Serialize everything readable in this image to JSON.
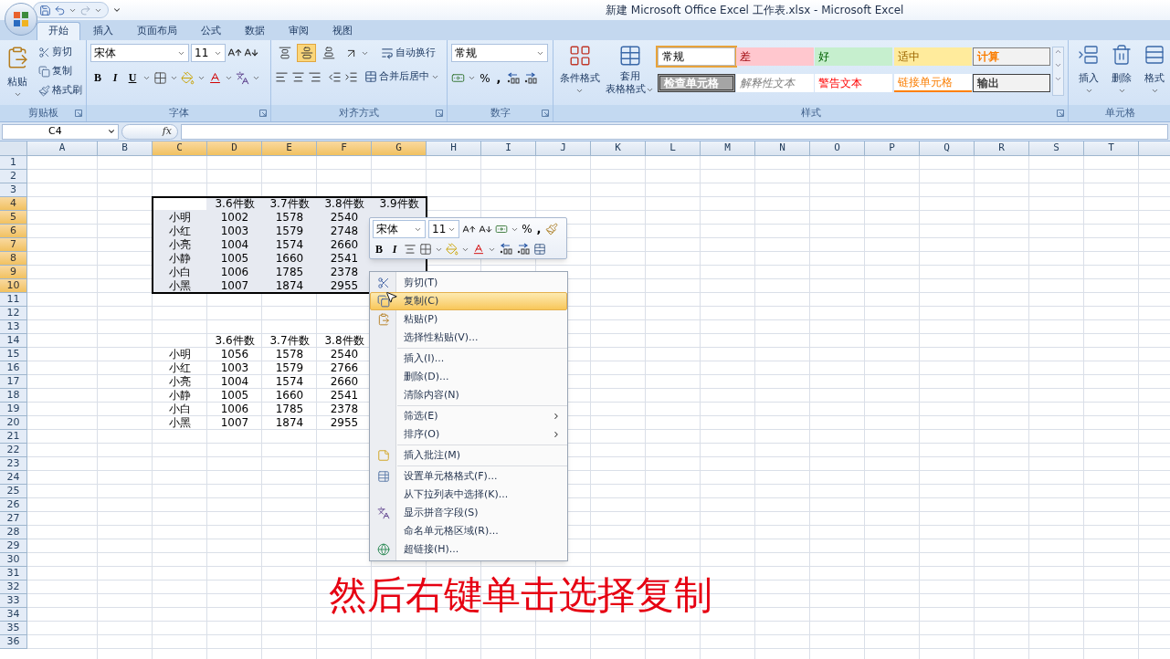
{
  "window": {
    "title": "新建 Microsoft Office Excel 工作表.xlsx - Microsoft Excel"
  },
  "tabs": [
    {
      "label": "开始",
      "selected": true
    },
    {
      "label": "插入",
      "selected": false
    },
    {
      "label": "页面布局",
      "selected": false
    },
    {
      "label": "公式",
      "selected": false
    },
    {
      "label": "数据",
      "selected": false
    },
    {
      "label": "审阅",
      "selected": false
    },
    {
      "label": "视图",
      "selected": false
    }
  ],
  "ribbon": {
    "clipboard": {
      "label": "剪贴板",
      "paste": "粘贴",
      "items": [
        {
          "kind": "cut",
          "label": "剪切"
        },
        {
          "kind": "copy",
          "label": "复制"
        },
        {
          "kind": "brush",
          "label": "格式刷"
        }
      ]
    },
    "font": {
      "label": "字体",
      "font_name": "宋体",
      "font_size": "11",
      "styles": [
        "B",
        "I",
        "U"
      ]
    },
    "alignment": {
      "label": "对齐方式",
      "vertical": [
        {
          "selected": false
        },
        {
          "selected": true
        },
        {
          "selected": false
        }
      ],
      "wrap": "自动换行",
      "merge": "合并后居中"
    },
    "number": {
      "label": "数字",
      "format": "常规",
      "percent": "%",
      "comma": ","
    },
    "styles": {
      "label": "样式",
      "conditional": "条件格式",
      "table_format": [
        "套用",
        "表格格式"
      ],
      "gallery": [
        {
          "label": "常规",
          "kind": "normal",
          "selected": true
        },
        {
          "label": "差",
          "kind": "bad",
          "selected": false
        },
        {
          "label": "好",
          "kind": "good",
          "selected": false
        },
        {
          "label": "适中",
          "kind": "neutral",
          "selected": false
        },
        {
          "label": "计算",
          "kind": "calculation",
          "selected": false
        },
        {
          "label": "检查单元格",
          "kind": "check",
          "selected": false
        },
        {
          "label": "解释性文本",
          "kind": "explanatory",
          "selected": false
        },
        {
          "label": "警告文本",
          "kind": "warning",
          "selected": false
        },
        {
          "label": "链接单元格",
          "kind": "linked",
          "selected": false
        },
        {
          "label": "输出",
          "kind": "output",
          "selected": false
        }
      ]
    },
    "cells": {
      "label": "单元格",
      "buttons": [
        "插入",
        "删除",
        "格式"
      ]
    }
  },
  "formula_bar": {
    "name_box": "C4",
    "function_label": "fx"
  },
  "sheet": {
    "columns": [
      {
        "label": "A",
        "selected": false
      },
      {
        "label": "B",
        "selected": false
      },
      {
        "label": "C",
        "selected": true
      },
      {
        "label": "D",
        "selected": true
      },
      {
        "label": "E",
        "selected": true
      },
      {
        "label": "F",
        "selected": true
      },
      {
        "label": "G",
        "selected": true
      },
      {
        "label": "H",
        "selected": false
      },
      {
        "label": "I",
        "selected": false
      },
      {
        "label": "J",
        "selected": false
      },
      {
        "label": "K",
        "selected": false
      },
      {
        "label": "L",
        "selected": false
      },
      {
        "label": "M",
        "selected": false
      },
      {
        "label": "N",
        "selected": false
      },
      {
        "label": "O",
        "selected": false
      },
      {
        "label": "P",
        "selected": false
      },
      {
        "label": "Q",
        "selected": false
      },
      {
        "label": "R",
        "selected": false
      },
      {
        "label": "S",
        "selected": false
      },
      {
        "label": "T",
        "selected": false
      }
    ],
    "rows": [
      {
        "label": "1",
        "selected": false
      },
      {
        "label": "2",
        "selected": false
      },
      {
        "label": "3",
        "selected": false
      },
      {
        "label": "4",
        "selected": true
      },
      {
        "label": "5",
        "selected": true
      },
      {
        "label": "6",
        "selected": true
      },
      {
        "label": "7",
        "selected": true
      },
      {
        "label": "8",
        "selected": true
      },
      {
        "label": "9",
        "selected": true
      },
      {
        "label": "10",
        "selected": true
      },
      {
        "label": "11",
        "selected": false
      },
      {
        "label": "12",
        "selected": false
      },
      {
        "label": "13",
        "selected": false
      },
      {
        "label": "14",
        "selected": false
      },
      {
        "label": "15",
        "selected": false
      },
      {
        "label": "16",
        "selected": false
      },
      {
        "label": "17",
        "selected": false
      },
      {
        "label": "18",
        "selected": false
      },
      {
        "label": "19",
        "selected": false
      },
      {
        "label": "20",
        "selected": false
      },
      {
        "label": "21",
        "selected": false
      },
      {
        "label": "22",
        "selected": false
      },
      {
        "label": "23",
        "selected": false
      },
      {
        "label": "24",
        "selected": false
      },
      {
        "label": "25",
        "selected": false
      },
      {
        "label": "26",
        "selected": false
      },
      {
        "label": "27",
        "selected": false
      },
      {
        "label": "28",
        "selected": false
      },
      {
        "label": "29",
        "selected": false
      },
      {
        "label": "30",
        "selected": false
      },
      {
        "label": "31",
        "selected": false
      },
      {
        "label": "32",
        "selected": false
      },
      {
        "label": "33",
        "selected": false
      },
      {
        "label": "34",
        "selected": false
      },
      {
        "label": "35",
        "selected": false
      },
      {
        "label": "36",
        "selected": false
      }
    ],
    "tables": [
      {
        "selected": true,
        "headers": [
          "3.6件数",
          "3.7件数",
          "3.8件数",
          "3.9件数"
        ],
        "rows": [
          {
            "name": "小明",
            "values": [
              "1002",
              "1578",
              "2540"
            ]
          },
          {
            "name": "小红",
            "values": [
              "1003",
              "1579",
              "2748"
            ]
          },
          {
            "name": "小亮",
            "values": [
              "1004",
              "1574",
              "2660"
            ]
          },
          {
            "name": "小静",
            "values": [
              "1005",
              "1660",
              "2541"
            ]
          },
          {
            "name": "小白",
            "values": [
              "1006",
              "1785",
              "2378"
            ]
          },
          {
            "name": "小黑",
            "values": [
              "1007",
              "1874",
              "2955"
            ]
          }
        ]
      },
      {
        "selected": false,
        "headers": [
          "3.6件数",
          "3.7件数",
          "3.8件数"
        ],
        "rows": [
          {
            "name": "小明",
            "values": [
              "1056",
              "1578",
              "2540"
            ]
          },
          {
            "name": "小红",
            "values": [
              "1003",
              "1579",
              "2766"
            ]
          },
          {
            "name": "小亮",
            "values": [
              "1004",
              "1574",
              "2660"
            ]
          },
          {
            "name": "小静",
            "values": [
              "1005",
              "1660",
              "2541"
            ]
          },
          {
            "name": "小白",
            "values": [
              "1006",
              "1785",
              "2378"
            ]
          },
          {
            "name": "小黑",
            "values": [
              "1007",
              "1874",
              "2955"
            ]
          }
        ]
      }
    ]
  },
  "mini_toolbar": {
    "font_name": "宋体",
    "font_size": "11",
    "percent": "%",
    "comma": ",",
    "styles": [
      "B",
      "I"
    ]
  },
  "context_menu": {
    "groups": [
      [
        {
          "label": "剪切(T)",
          "kind": "cut",
          "selected": false
        },
        {
          "label": "复制(C)",
          "kind": "copy",
          "selected": true
        },
        {
          "label": "粘贴(P)",
          "kind": "paste",
          "selected": false
        },
        {
          "label": "选择性粘贴(V)...",
          "kind": "plain",
          "selected": false
        }
      ],
      [
        {
          "label": "插入(I)...",
          "kind": "plain",
          "selected": false
        },
        {
          "label": "删除(D)...",
          "kind": "plain",
          "selected": false
        },
        {
          "label": "清除内容(N)",
          "kind": "plain",
          "selected": false
        }
      ],
      [
        {
          "label": "筛选(E)",
          "kind": "submenu",
          "selected": false
        },
        {
          "label": "排序(O)",
          "kind": "submenu",
          "selected": false
        }
      ],
      [
        {
          "label": "插入批注(M)",
          "kind": "comment",
          "selected": false
        }
      ],
      [
        {
          "label": "设置单元格格式(F)...",
          "kind": "format",
          "selected": false
        },
        {
          "label": "从下拉列表中选择(K)...",
          "kind": "plain",
          "selected": false
        },
        {
          "label": "显示拼音字段(S)",
          "kind": "phonetic",
          "selected": false
        },
        {
          "label": "命名单元格区域(R)...",
          "kind": "plain",
          "selected": false
        },
        {
          "label": "超链接(H)...",
          "kind": "link",
          "selected": false
        }
      ]
    ]
  },
  "caption": "然后右键单击选择复制"
}
